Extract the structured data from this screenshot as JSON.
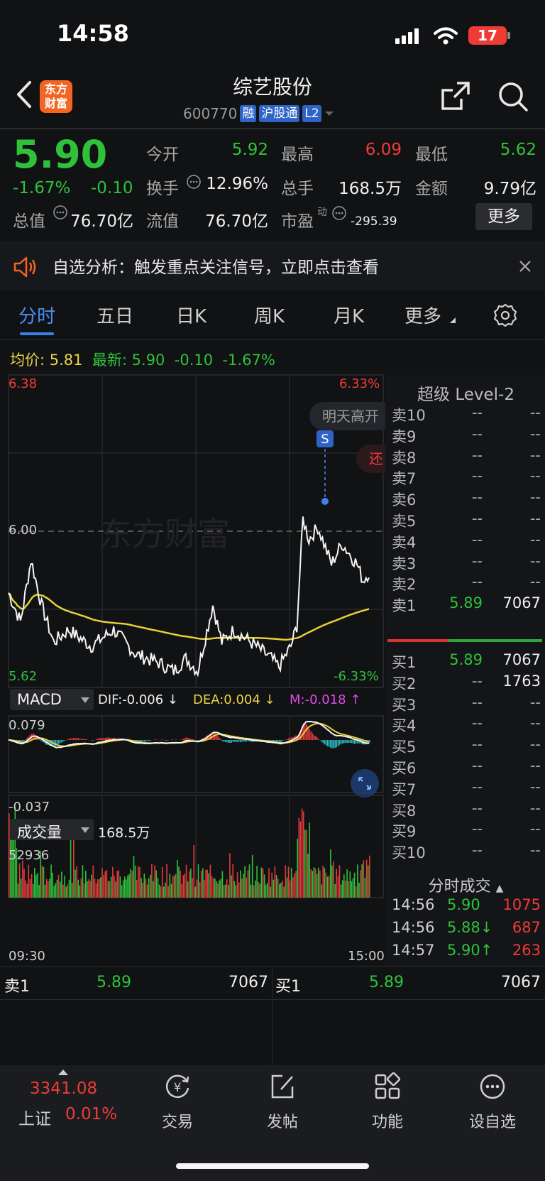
{
  "status": {
    "time": "14:58",
    "battery": "17"
  },
  "header": {
    "logo_line1": "东方",
    "logo_line2": "财富",
    "title": "综艺股份",
    "code": "600770",
    "tags": [
      "融",
      "沪股通",
      "L2"
    ]
  },
  "quote": {
    "price": "5.90",
    "pct": "-1.67%",
    "change": "-0.10",
    "open_label": "今开",
    "open": "5.92",
    "high_label": "最高",
    "high": "6.09",
    "low_label": "最低",
    "low": "5.62",
    "turnover_label": "换手",
    "turnover": "12.96%",
    "volume_label": "总手",
    "volume": "168.5万",
    "amount_label": "金额",
    "amount": "9.79亿",
    "mktcap_label": "总值",
    "mktcap": "76.70亿",
    "float_label": "流值",
    "float": "76.70亿",
    "pe_label": "市盈",
    "pe_sup": "动",
    "pe": "-295.39",
    "more": "更多"
  },
  "notice": {
    "text": "自选分析：触发重点关注信号，立即点击查看"
  },
  "tabs": [
    "分时",
    "五日",
    "日K",
    "周K",
    "月K",
    "更多"
  ],
  "info": {
    "avg_label": "均价:",
    "avg": "5.81",
    "latest_label": "最新:",
    "latest": "5.90",
    "chg": "-0.10",
    "pct": "-1.67%"
  },
  "axis": {
    "top": "6.38",
    "top_pct": "6.33%",
    "mid": "6.00",
    "bottom": "5.62",
    "bottom_pct": "-6.33%",
    "time_start": "09:30",
    "time_end": "15:00"
  },
  "overlay": {
    "bubble": "明天高开",
    "badge": "S",
    "partial": "还",
    "watermark": "东方财富"
  },
  "macd": {
    "label": "MACD",
    "dif": "DIF:-0.006 ↓",
    "dea": "DEA:0.004 ↓",
    "m": "M:-0.018 ↑",
    "top": "0.079",
    "bottom": "-0.037"
  },
  "vol": {
    "label": "成交量",
    "total": "168.5万",
    "max": "52936"
  },
  "level2": {
    "title": "超级 Level-2",
    "asks": [
      {
        "n": "卖10",
        "p": "--",
        "v": "--"
      },
      {
        "n": "卖9",
        "p": "--",
        "v": "--"
      },
      {
        "n": "卖8",
        "p": "--",
        "v": "--"
      },
      {
        "n": "卖7",
        "p": "--",
        "v": "--"
      },
      {
        "n": "卖6",
        "p": "--",
        "v": "--"
      },
      {
        "n": "卖5",
        "p": "--",
        "v": "--"
      },
      {
        "n": "卖4",
        "p": "--",
        "v": "--"
      },
      {
        "n": "卖3",
        "p": "--",
        "v": "--"
      },
      {
        "n": "卖2",
        "p": "--",
        "v": "--"
      },
      {
        "n": "卖1",
        "p": "5.89",
        "v": "7067"
      }
    ],
    "bids": [
      {
        "n": "买1",
        "p": "5.89",
        "v": "7067"
      },
      {
        "n": "买2",
        "p": "--",
        "v": "1763"
      },
      {
        "n": "买3",
        "p": "--",
        "v": "--"
      },
      {
        "n": "买4",
        "p": "--",
        "v": "--"
      },
      {
        "n": "买5",
        "p": "--",
        "v": "--"
      },
      {
        "n": "买6",
        "p": "--",
        "v": "--"
      },
      {
        "n": "买7",
        "p": "--",
        "v": "--"
      },
      {
        "n": "买8",
        "p": "--",
        "v": "--"
      },
      {
        "n": "买9",
        "p": "--",
        "v": "--"
      },
      {
        "n": "买10",
        "p": "--",
        "v": "--"
      }
    ]
  },
  "ticks": {
    "title": "分时成交",
    "rows": [
      {
        "t": "14:56",
        "p": "5.90",
        "v": "1075"
      },
      {
        "t": "14:56",
        "p": "5.88↓",
        "v": "687"
      },
      {
        "t": "14:57",
        "p": "5.90↑",
        "v": "263"
      }
    ]
  },
  "strip": {
    "sell_label": "卖1",
    "sell_p": "5.89",
    "sell_v": "7067",
    "buy_label": "买1",
    "buy_p": "5.89",
    "buy_v": "7067"
  },
  "nav": {
    "index_value": "3341.08",
    "index_name": "上证",
    "index_pct": "0.01%",
    "items": [
      "交易",
      "发帖",
      "功能",
      "设自选"
    ]
  }
}
